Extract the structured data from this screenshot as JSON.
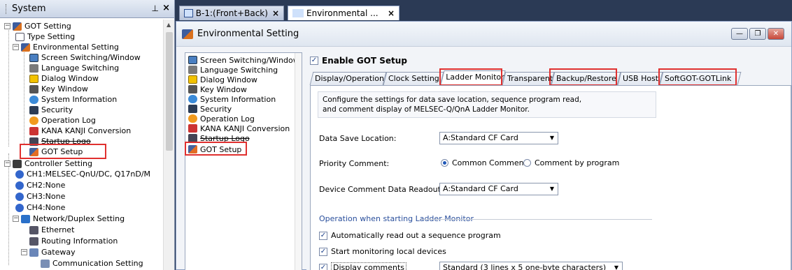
{
  "system_pane": {
    "title": "System",
    "pin_icon": "pin-icon",
    "close": "×",
    "tree": [
      {
        "label": "GOT Setting",
        "icon": "got-icon",
        "expander": "−"
      },
      {
        "label": "Type Setting",
        "icon": "document-icon"
      },
      {
        "label": "Environmental Setting",
        "icon": "got-icon",
        "expander": "−"
      },
      {
        "label": "Screen Switching/Window",
        "icon": "screen-icon"
      },
      {
        "label": "Language Switching",
        "icon": "language-icon"
      },
      {
        "label": "Dialog Window",
        "icon": "warning-icon"
      },
      {
        "label": "Key Window",
        "icon": "keyboard-icon"
      },
      {
        "label": "System Information",
        "icon": "info-icon"
      },
      {
        "label": "Security",
        "icon": "security-icon"
      },
      {
        "label": "Operation Log",
        "icon": "operation-log-icon"
      },
      {
        "label": "KANA KANJI Conversion",
        "icon": "kana-icon"
      },
      {
        "label": "Startup Logo",
        "icon": "logo-icon"
      },
      {
        "label": "GOT Setup",
        "icon": "got-setup-icon"
      },
      {
        "label": "Controller Setting",
        "icon": "controller-icon",
        "expander": "−"
      },
      {
        "label": "CH1:MELSEC-QnU/DC, Q17nD/M",
        "icon": "channel-icon"
      },
      {
        "label": "CH2:None",
        "icon": "channel-icon"
      },
      {
        "label": "CH3:None",
        "icon": "channel-icon"
      },
      {
        "label": "CH4:None",
        "icon": "channel-icon"
      },
      {
        "label": "Network/Duplex Setting",
        "icon": "network-icon",
        "expander": "−"
      },
      {
        "label": "Ethernet",
        "icon": "ethernet-icon"
      },
      {
        "label": "Routing Information",
        "icon": "routing-icon"
      },
      {
        "label": "Gateway",
        "icon": "gateway-icon",
        "expander": "−"
      },
      {
        "label": "Communication Setting",
        "icon": "communication-icon"
      }
    ]
  },
  "doc_tabs": [
    {
      "label": "B-1:(Front+Back)",
      "close": "×"
    },
    {
      "label": "Environmental ...",
      "close": "×"
    }
  ],
  "window": {
    "title": "Environmental Setting",
    "controls": [
      "minimize",
      "restore",
      "close"
    ]
  },
  "nav_list": [
    "Screen Switching/Window",
    "Language Switching",
    "Dialog Window",
    "Key Window",
    "System Information",
    "Security",
    "Operation Log",
    "KANA KANJI Conversion",
    "Startup Logo",
    "GOT Setup"
  ],
  "panel": {
    "enable_label": "Enable GOT Setup",
    "enable_checked": true,
    "tabs": [
      "Display/Operation",
      "Clock Setting",
      "Ladder Monitor",
      "Transparent",
      "Backup/Restore",
      "USB Host",
      "SoftGOT-GOTLink"
    ],
    "active_tab": "Ladder Monitor",
    "description_line1": "Configure the settings for data save location, sequence program read,",
    "description_line2": "and comment display of MELSEC-Q/QnA Ladder Monitor.",
    "data_save_label": "Data Save Location:",
    "data_save_value": "A:Standard CF Card",
    "priority_label": "Priority Comment:",
    "radio_common": "Common Comment",
    "radio_program": "Comment by program",
    "device_readout_label": "Device Comment Data Readout:",
    "device_readout_value": "A:Standard CF Card",
    "group_title": "Operation when starting Ladder Monitor",
    "check_auto_read": "Automatically read out a sequence program",
    "check_start_monitor": "Start monitoring local devices",
    "check_display_comments": "Display comments",
    "display_comments_value": "Standard (3 lines x 5 one-byte characters)"
  },
  "colors": {
    "highlight_box": "#e0302f",
    "background": "#2b3a55"
  }
}
